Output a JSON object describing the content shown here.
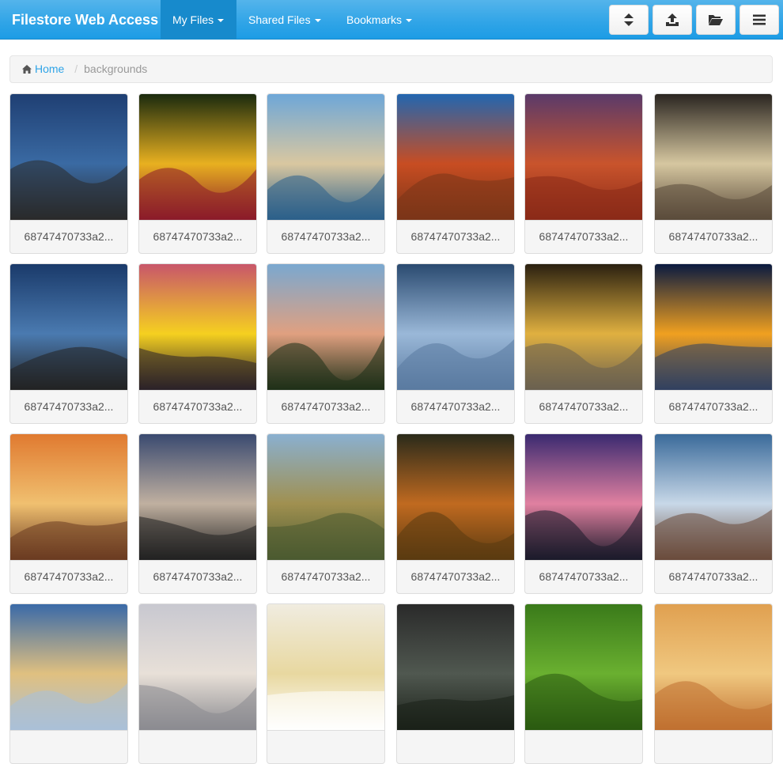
{
  "navbar": {
    "brand": "Filestore Web Access",
    "menus": [
      {
        "label": "My Files",
        "active": true
      },
      {
        "label": "Shared Files",
        "active": false
      },
      {
        "label": "Bookmarks",
        "active": false
      }
    ],
    "tools": [
      {
        "icon": "sort-icon"
      },
      {
        "icon": "upload-icon"
      },
      {
        "icon": "folder-open-icon"
      },
      {
        "icon": "menu-icon"
      }
    ],
    "colors": {
      "primary": "#2fa4e7",
      "active": "#178acc"
    }
  },
  "breadcrumb": {
    "home_icon": "home-icon",
    "home_label": "Home",
    "current": "backgrounds"
  },
  "files": [
    {
      "name": "68747470733a2..."
    },
    {
      "name": "68747470733a2..."
    },
    {
      "name": "68747470733a2..."
    },
    {
      "name": "68747470733a2..."
    },
    {
      "name": "68747470733a2..."
    },
    {
      "name": "68747470733a2..."
    },
    {
      "name": "68747470733a2..."
    },
    {
      "name": "68747470733a2..."
    },
    {
      "name": "68747470733a2..."
    },
    {
      "name": "68747470733a2..."
    },
    {
      "name": "68747470733a2..."
    },
    {
      "name": "68747470733a2..."
    },
    {
      "name": "68747470733a2..."
    },
    {
      "name": "68747470733a2..."
    },
    {
      "name": "68747470733a2..."
    },
    {
      "name": "68747470733a2..."
    },
    {
      "name": "68747470733a2..."
    },
    {
      "name": "68747470733a2..."
    },
    {
      "name": ""
    },
    {
      "name": ""
    },
    {
      "name": ""
    },
    {
      "name": ""
    },
    {
      "name": ""
    },
    {
      "name": ""
    }
  ]
}
